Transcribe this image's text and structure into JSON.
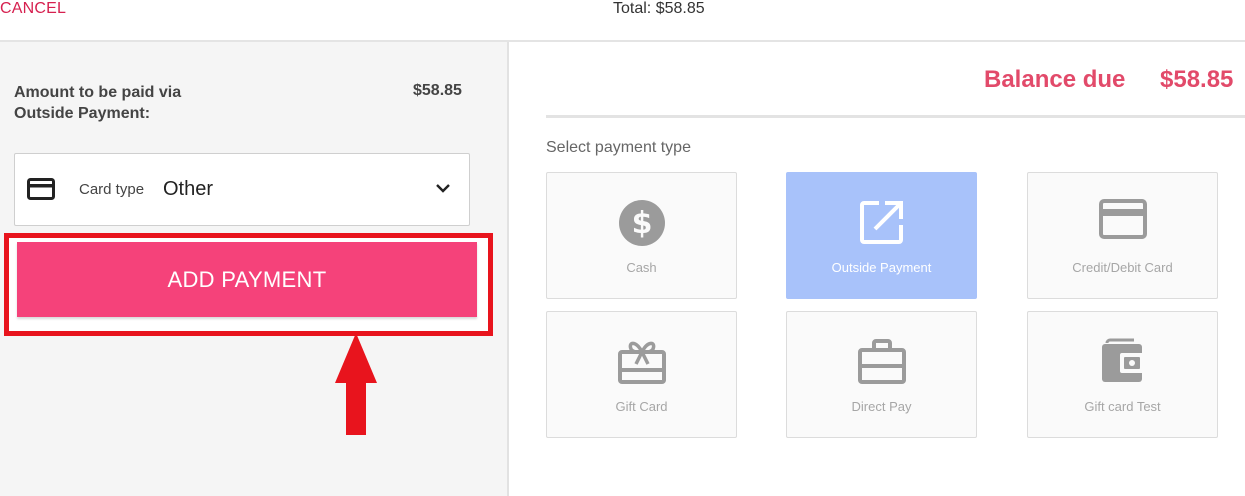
{
  "header": {
    "cancel_label": "CANCEL",
    "total_text": "Total: $58.85"
  },
  "left": {
    "amount_label_line1": "Amount to be paid via",
    "amount_label_line2": "Outside Payment:",
    "amount_value": "$58.85",
    "card_select": {
      "label": "Card type",
      "value": "Other",
      "icon": "credit-card-icon"
    },
    "add_payment_label": "ADD PAYMENT"
  },
  "right": {
    "balance_label": "Balance due",
    "balance_value": "$58.85",
    "select_label": "Select payment type",
    "tiles": [
      {
        "label": "Cash",
        "icon": "dollar-circle-icon",
        "selected": false
      },
      {
        "label": "Outside Payment",
        "icon": "external-link-icon",
        "selected": true
      },
      {
        "label": "Credit/Debit Card",
        "icon": "credit-card-icon",
        "selected": false
      },
      {
        "label": "Gift Card",
        "icon": "gift-card-icon",
        "selected": false
      },
      {
        "label": "Direct Pay",
        "icon": "briefcase-icon",
        "selected": false
      },
      {
        "label": "Gift card Test",
        "icon": "wallet-icon",
        "selected": false
      }
    ]
  },
  "annotation": {
    "highlight_color": "#e8141d",
    "arrow_color": "#e8141d"
  },
  "colors": {
    "accent": "#f5427a",
    "balance": "#e24a6a",
    "selected_tile": "#a8c2fa"
  }
}
